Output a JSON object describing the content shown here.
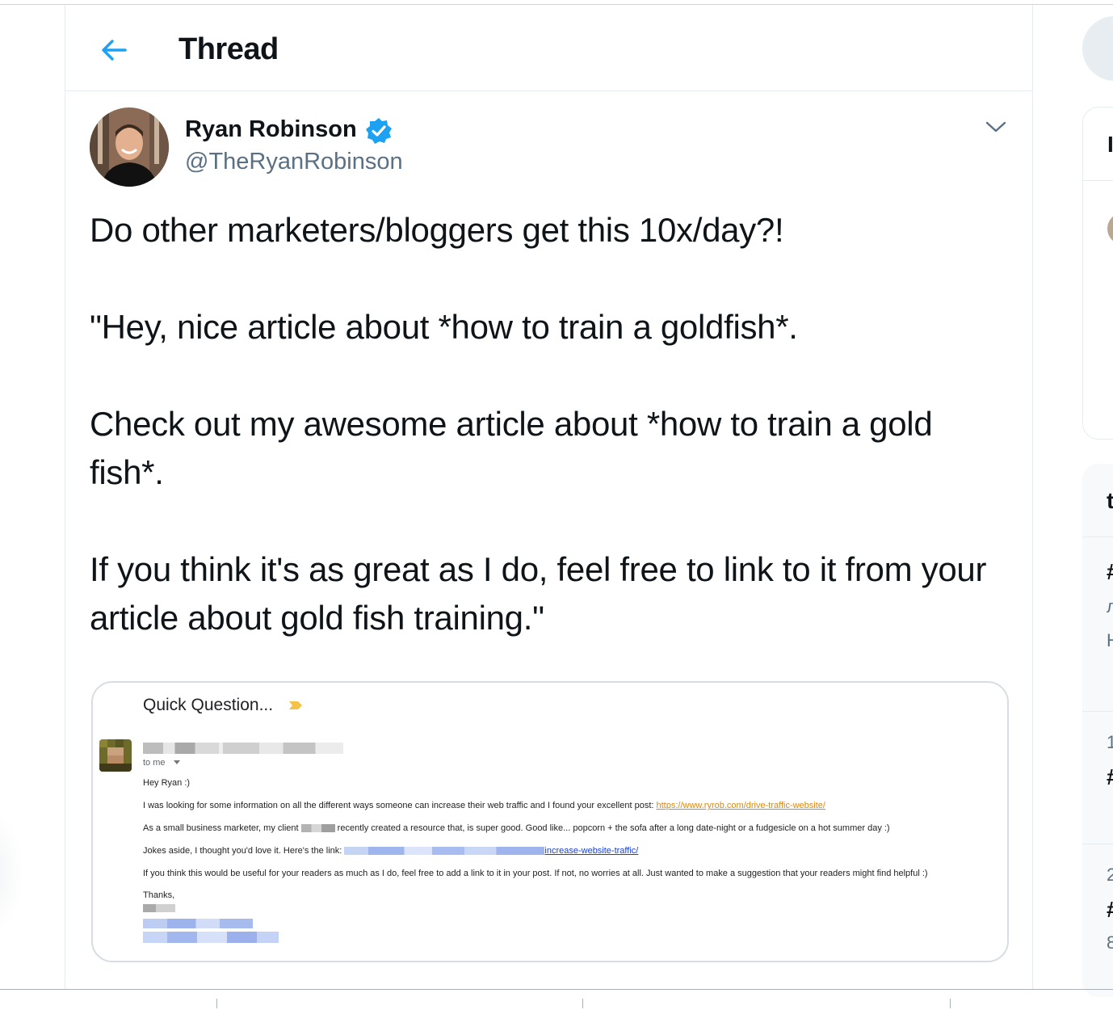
{
  "header": {
    "title": "Thread",
    "back_icon": "arrow-left-icon",
    "accent": "#1da1f2"
  },
  "tweet": {
    "author_name": "Ryan Robinson",
    "author_handle": "@TheRyanRobinson",
    "verified_icon": "verified-badge-icon",
    "menu_icon": "chevron-down-icon",
    "paragraphs": [
      "Do other marketers/bloggers get this 10x/day?!",
      "\"Hey, nice article about *how to train a goldfish*.",
      "Check out my awesome article about *how to train a gold fish*.",
      "If you think it's as great as I do, feel free to link to it from your article about gold fish training.\""
    ]
  },
  "media": {
    "subject": "Quick Question...",
    "to_me": "to me",
    "greeting": "Hey Ryan :)",
    "line1": "I was looking for some information on all the different ways someone can increase their web traffic and I found your excellent post: ",
    "line1_link": "https://www.ryrob.com/drive-traffic-website/",
    "line2_a": "As a small business marketer, my client ",
    "line2_b": " recently created a resource that, is super good. Good like... popcorn + the sofa after a long date-night or a fudgesicle on a hot summer day :)",
    "line3": "Jokes aside, I thought you'd love it. Here's the link: ",
    "line3_link": "increase-website-traffic/",
    "line4": "If you think this would be useful for your readers as much as I do, feel free to add a link to it in your post. If not, no worries at all. Just wanted to make a suggestion that your readers might find helpful :)",
    "thanks": "Thanks,"
  },
  "right_column": {
    "card1_glyph": "I",
    "card2_glyphs": [
      "t",
      "#",
      "л",
      "H",
      "1",
      "#",
      "2",
      "#",
      "8"
    ]
  }
}
